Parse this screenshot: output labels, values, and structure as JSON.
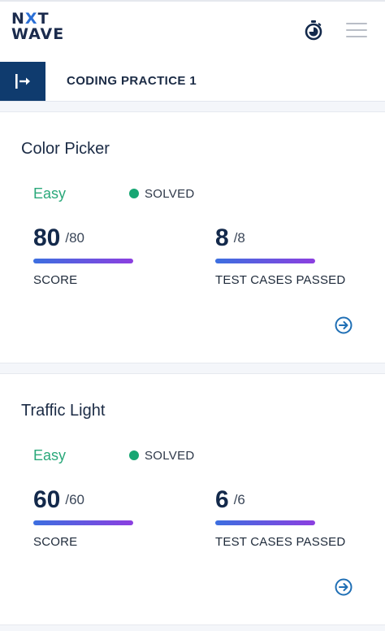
{
  "header": {
    "logo_line1_a": "N",
    "logo_line1_x": "X",
    "logo_line1_b": "T",
    "logo_line2": "WAVE",
    "timer_icon": "stopwatch-icon",
    "menu_icon": "hamburger-menu-icon"
  },
  "subheader": {
    "toggle_icon": "sidebar-expand-icon",
    "title": "CODING PRACTICE 1"
  },
  "problems": [
    {
      "title": "Color Picker",
      "difficulty": "Easy",
      "status": "SOLVED",
      "score": "80",
      "score_total": "/80",
      "score_label": "SCORE",
      "score_progress": 1.0,
      "tests": "8",
      "tests_total": "/8",
      "tests_label": "TEST CASES PASSED",
      "tests_progress": 1.0
    },
    {
      "title": "Traffic Light",
      "difficulty": "Easy",
      "status": "SOLVED",
      "score": "60",
      "score_total": "/60",
      "score_label": "SCORE",
      "score_progress": 1.0,
      "tests": "6",
      "tests_total": "/6",
      "tests_label": "TEST CASES PASSED",
      "tests_progress": 1.0
    }
  ],
  "colors": {
    "brand_navy": "#0f3b6e",
    "easy_green": "#2aa87a",
    "solved_dot": "#17a673",
    "progress_start": "#3c6fe0",
    "progress_end": "#8c3fe0",
    "arrow_blue": "#1f6fb5"
  }
}
